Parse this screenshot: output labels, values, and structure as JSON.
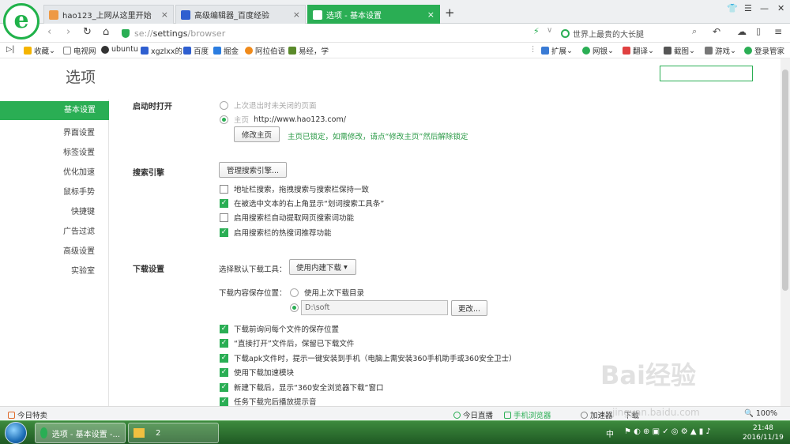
{
  "browser": {
    "tabs": [
      {
        "label": "hao123_上网从这里开始",
        "active": false
      },
      {
        "label": "高级编辑器_百度经验",
        "active": false
      },
      {
        "label": "选项 - 基本设置",
        "active": true
      }
    ],
    "new_tab": "+",
    "close": "×",
    "url_prefix": "se://",
    "url_main": "settings",
    "url_suffix": "/browser",
    "search_placeholder": "世界上最贵的大长腿",
    "accent": "#2aae54"
  },
  "bookmarks": {
    "left": [
      "收藏",
      "电视网",
      "ubuntu",
      "xgzlxx的",
      "百度",
      "掘金",
      "阿拉伯语",
      "易经，学"
    ],
    "right": [
      "扩展",
      "网银",
      "翻译",
      "截图",
      "游戏",
      "登录管家"
    ]
  },
  "page": {
    "title": "选项",
    "sidebar": [
      "基本设置",
      "界面设置",
      "标签设置",
      "优化加速",
      "鼠标手势",
      "快捷键",
      "广告过滤",
      "高级设置",
      "实验室"
    ],
    "startup": {
      "heading": "启动时打开",
      "opt_last": "上次退出时未关闭的页面",
      "opt_home": "主页",
      "home_url": "http://www.hao123.com/",
      "edit_btn": "修改主页",
      "locked_msg": "主页已锁定，如需修改，请点“修改主页”然后解除锁定"
    },
    "search": {
      "heading": "搜索引擎",
      "manage_btn": "管理搜索引擎...",
      "options": [
        {
          "label": "地址栏搜索，拖拽搜索与搜索栏保持一致",
          "checked": false
        },
        {
          "label": "在被选中文本的右上角显示“划词搜索工具条”",
          "checked": true
        },
        {
          "label": "启用搜索栏自动提取网页搜索词功能",
          "checked": false
        },
        {
          "label": "启用搜索栏的热搜词推荐功能",
          "checked": true
        }
      ]
    },
    "download": {
      "heading": "下载设置",
      "tool_label": "选择默认下载工具：",
      "tool_value": "使用内建下载",
      "save_label": "下载内容保存位置：",
      "opt_last_dir": "使用上次下载目录",
      "path": "D:\\soft",
      "change_btn": "更改...",
      "options": [
        {
          "label": "下载前询问每个文件的保存位置",
          "checked": true
        },
        {
          "label": "“直接打开”文件后，保留已下载文件",
          "checked": true
        },
        {
          "label": "下载apk文件时，提示一键安装到手机（电脑上需安装360手机助手或360安全卫士）",
          "checked": true
        },
        {
          "label": "使用下载加速模块",
          "checked": true
        },
        {
          "label": "新建下载后，显示“360安全浏览器下载”窗口",
          "checked": true
        },
        {
          "label": "任务下载完后播放提示音",
          "checked": true
        }
      ]
    }
  },
  "status": {
    "left": "今日特卖",
    "items": [
      "今日直播",
      "手机浏览器",
      "加速器",
      "下载"
    ],
    "zoom": "100%"
  },
  "taskbar": {
    "items": [
      "选项 - 基本设置 -...",
      "2"
    ],
    "ime": "中",
    "time": "21:48",
    "date": "2016/11/19"
  },
  "watermark": "Bai经验",
  "watermark_sub": "jingyan.baidu.com"
}
